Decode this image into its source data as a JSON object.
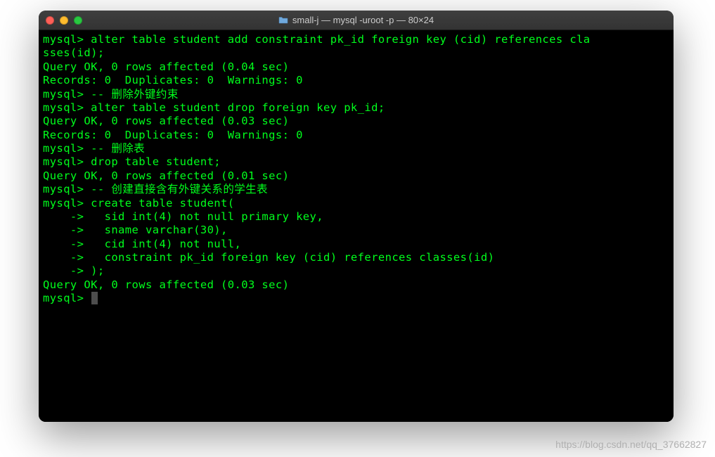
{
  "window": {
    "title": "small-j — mysql -uroot -p — 80×24"
  },
  "terminal": {
    "lines": [
      "mysql> alter table student add constraint pk_id foreign key (cid) references cla",
      "sses(id);",
      "Query OK, 0 rows affected (0.04 sec)",
      "Records: 0  Duplicates: 0  Warnings: 0",
      "",
      "mysql> -- 删除外键约束",
      "mysql> alter table student drop foreign key pk_id;",
      "Query OK, 0 rows affected (0.03 sec)",
      "Records: 0  Duplicates: 0  Warnings: 0",
      "",
      "mysql> -- 删除表",
      "mysql> drop table student;",
      "Query OK, 0 rows affected (0.01 sec)",
      "",
      "mysql> -- 创建直接含有外键关系的学生表",
      "mysql> create table student(",
      "    ->   sid int(4) not null primary key,",
      "    ->   sname varchar(30),",
      "    ->   cid int(4) not null,",
      "    ->   constraint pk_id foreign key (cid) references classes(id)",
      "    -> );",
      "Query OK, 0 rows affected (0.03 sec)",
      "",
      "mysql> "
    ]
  },
  "watermark": "https://blog.csdn.net/qq_37662827"
}
